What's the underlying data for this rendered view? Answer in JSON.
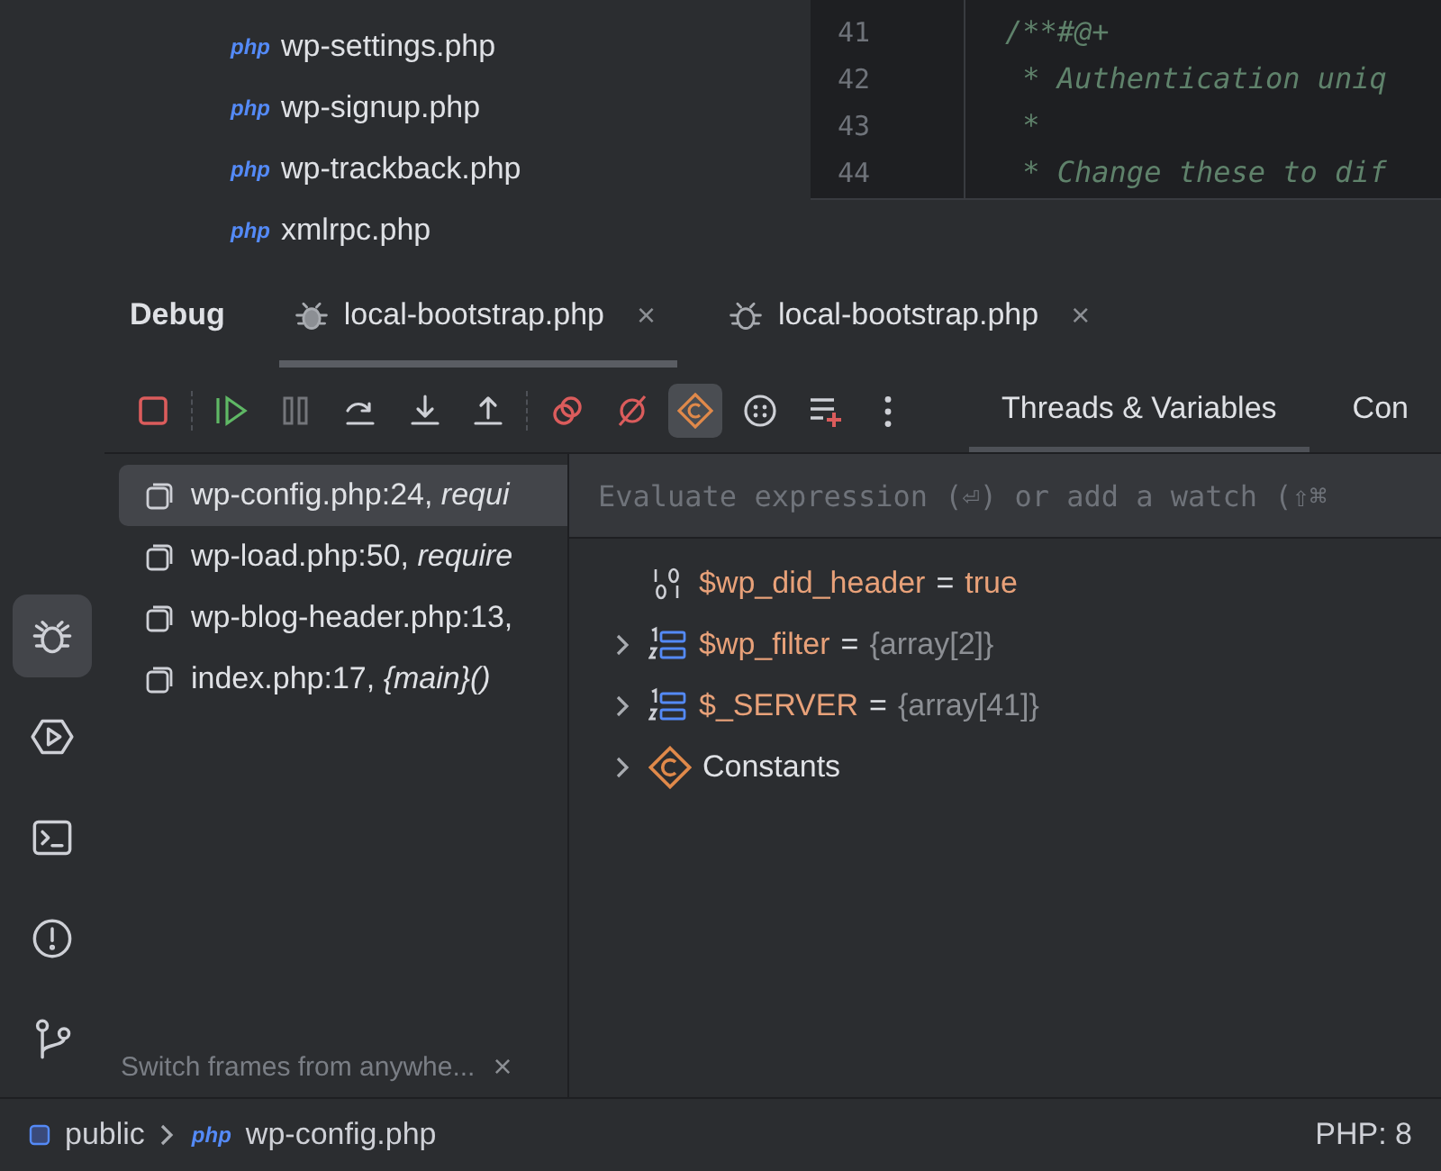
{
  "project_tree": {
    "items": [
      {
        "badge": "php",
        "name": "wp-settings.php"
      },
      {
        "badge": "php",
        "name": "wp-signup.php"
      },
      {
        "badge": "php",
        "name": "wp-trackback.php"
      },
      {
        "badge": "php",
        "name": "xmlrpc.php"
      }
    ]
  },
  "editor": {
    "lines": [
      {
        "number": "41",
        "code": "/**#@+"
      },
      {
        "number": "42",
        "code": " * Authentication uniq"
      },
      {
        "number": "43",
        "code": " *"
      },
      {
        "number": "44",
        "code": " * Change these to dif"
      }
    ]
  },
  "tool_stripe": [
    {
      "kind": "debug",
      "selected": true
    },
    {
      "kind": "services",
      "selected": false
    },
    {
      "kind": "terminal",
      "selected": false
    },
    {
      "kind": "problems",
      "selected": false
    },
    {
      "kind": "git",
      "selected": false
    }
  ],
  "debug": {
    "title": "Debug",
    "tabs": [
      {
        "label": "local-bootstrap.php",
        "close": "×",
        "selected": true
      },
      {
        "label": "local-bootstrap.php",
        "close": "×",
        "selected": false
      }
    ],
    "toolbar": [
      {
        "kind": "stop",
        "selected": false,
        "disabled": false
      },
      {
        "kind": "resume",
        "selected": false,
        "disabled": false
      },
      {
        "kind": "pause",
        "selected": false,
        "disabled": true
      },
      {
        "kind": "step-over",
        "selected": false,
        "disabled": false
      },
      {
        "kind": "step-into",
        "selected": false,
        "disabled": false
      },
      {
        "kind": "step-out",
        "selected": false,
        "disabled": false
      },
      {
        "kind": "breakpoints",
        "selected": false,
        "disabled": false
      },
      {
        "kind": "mute",
        "selected": false,
        "disabled": false
      },
      {
        "kind": "constants",
        "selected": true,
        "disabled": false
      },
      {
        "kind": "more-circle",
        "selected": false,
        "disabled": false
      },
      {
        "kind": "add-watch",
        "selected": false,
        "disabled": false
      },
      {
        "kind": "menu",
        "selected": false,
        "disabled": false
      }
    ],
    "panel_tabs": [
      {
        "label": "Threads & Variables",
        "selected": true
      },
      {
        "label": "Con",
        "selected": false
      }
    ],
    "frames": [
      {
        "text": "wp-config.php:24, *requi*",
        "selected": true
      },
      {
        "text": "wp-load.php:50, *require*",
        "selected": false
      },
      {
        "text": "wp-blog-header.php:13,",
        "selected": false
      },
      {
        "text": "index.php:17, *{main}()*",
        "selected": false
      }
    ],
    "hint": {
      "text": "Switch frames from anywhe...",
      "close": "×"
    },
    "evaluate": {
      "placeholder": "Evaluate expression (⏎) or add a watch (⇧⌘"
    },
    "variables": [
      {
        "kind": "primitive",
        "name": "$wp_did_header",
        "operator": "=",
        "value": "true",
        "expandable": false
      },
      {
        "kind": "array",
        "name": "$wp_filter",
        "operator": "=",
        "value": "{array[2]}",
        "expandable": true
      },
      {
        "kind": "array",
        "name": "$_SERVER",
        "operator": "=",
        "value": "{array[41]}",
        "expandable": true
      },
      {
        "kind": "constants",
        "name": "Constants",
        "expandable": true
      }
    ]
  },
  "status_bar": {
    "breadcrumbs": [
      {
        "kind": "folder",
        "label": "public"
      },
      {
        "kind": "file",
        "badge": "php",
        "label": "wp-config.php"
      }
    ],
    "language": "PHP: 8"
  }
}
